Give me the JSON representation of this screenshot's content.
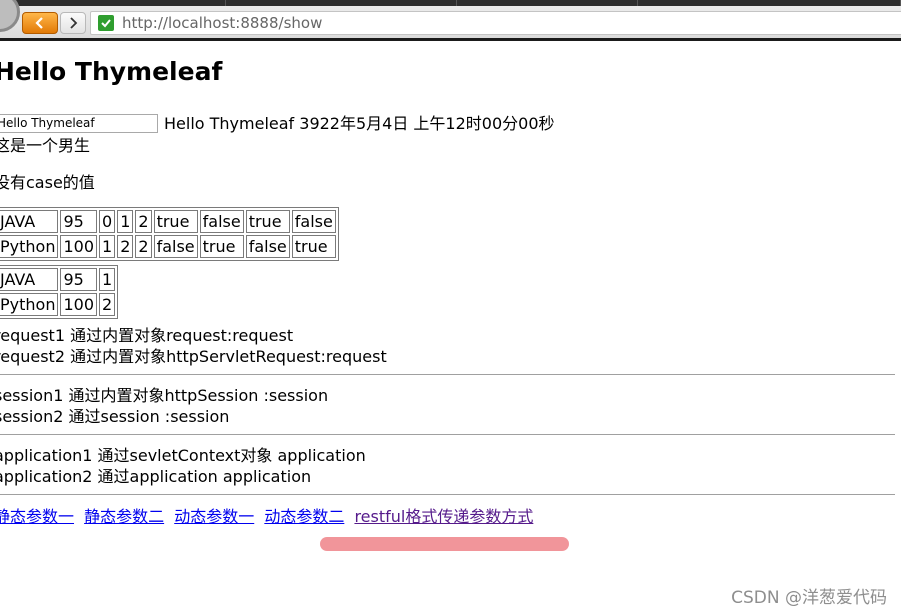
{
  "browser": {
    "url": "http://localhost:8888/show",
    "colors": {
      "back_button": "#f39a1c",
      "secure_badge": "#2f9e2f"
    }
  },
  "page": {
    "heading": "Hello Thymeleaf",
    "input_value": "Hello Thymeleaf",
    "text_after_input": "Hello Thymeleaf 3922年5月4日 上午12时00分00秒",
    "gender_line": "这是一个男生",
    "case_line": "没有case的值",
    "table1": [
      [
        "JAVA",
        "95",
        "0",
        "1",
        "2",
        "true",
        "false",
        "true",
        "false"
      ],
      [
        "Python",
        "100",
        "1",
        "2",
        "2",
        "false",
        "true",
        "false",
        "true"
      ]
    ],
    "table2": [
      [
        "JAVA",
        "95",
        "1"
      ],
      [
        "Python",
        "100",
        "2"
      ]
    ],
    "request_lines": [
      "request1 通过内置对象request:request",
      "request2 通过内置对象httpServletRequest:request"
    ],
    "session_lines": [
      "session1 通过内置对象httpSession :session",
      "session2 通过session :session"
    ],
    "application_lines": [
      "application1 通过sevletContext对象 application",
      "application2 通过application application"
    ],
    "links": [
      "静态参数一",
      "静态参数二",
      "动态参数一",
      "动态参数二",
      "restful格式传递参数方式"
    ],
    "colors": {
      "link": "#0000ee",
      "visited_link": "#551a8b",
      "annotation_stroke": "#f08a8f"
    }
  },
  "watermark": "CSDN @洋葱爱代码"
}
